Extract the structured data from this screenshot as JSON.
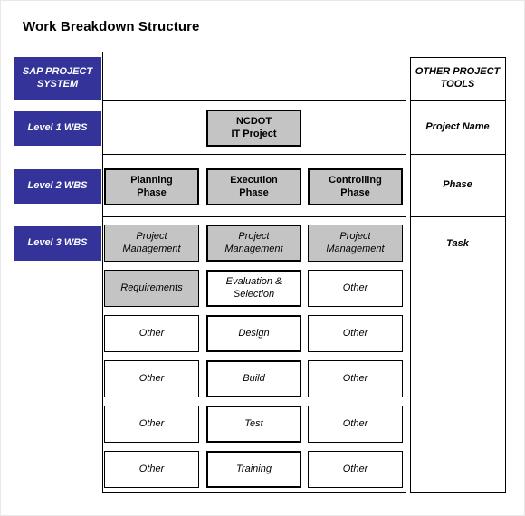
{
  "page": {
    "title": "Work Breakdown Structure",
    "colors": {
      "level_label_blue": "#333399",
      "node_gray": "#c4c4c4",
      "line_black": "#000000",
      "background": "#ffffff"
    }
  },
  "left_labels": [
    {
      "id": "sap-project-system",
      "line1": "SAP PROJECT",
      "line2": "SYSTEM"
    },
    {
      "id": "level-1-wbs",
      "line1": "Level 1 WBS",
      "line2": ""
    },
    {
      "id": "level-2-wbs",
      "line1": "Level 2 WBS",
      "line2": ""
    },
    {
      "id": "level-3-wbs",
      "line1": "Level 3 WBS",
      "line2": ""
    }
  ],
  "right_column": [
    {
      "id": "other-project-tools",
      "line1": "OTHER PROJECT",
      "line2": "TOOLS"
    },
    {
      "id": "project-name",
      "line1": "Project Name",
      "line2": ""
    },
    {
      "id": "phase",
      "line1": "Phase",
      "line2": ""
    },
    {
      "id": "task",
      "line1": "Task",
      "line2": ""
    }
  ],
  "level1": {
    "node": {
      "line1": "NCDOT",
      "line2": "IT Project",
      "fill": "gray",
      "border": "thick"
    }
  },
  "level2": {
    "nodes": [
      {
        "line1": "Planning",
        "line2": "Phase",
        "fill": "gray",
        "border": "thick"
      },
      {
        "line1": "Execution",
        "line2": "Phase",
        "fill": "gray",
        "border": "thick"
      },
      {
        "line1": "Controlling",
        "line2": "Phase",
        "fill": "gray",
        "border": "thick"
      }
    ]
  },
  "level3": {
    "rows": [
      {
        "cells": [
          {
            "line1": "Project",
            "line2": "Management",
            "fill": "gray",
            "border": "thin"
          },
          {
            "line1": "Project",
            "line2": "Management",
            "fill": "gray",
            "border": "thick"
          },
          {
            "line1": "Project",
            "line2": "Management",
            "fill": "gray",
            "border": "thin"
          }
        ]
      },
      {
        "cells": [
          {
            "line1": "Requirements",
            "line2": "",
            "fill": "gray",
            "border": "thin"
          },
          {
            "line1": "Evaluation &",
            "line2": "Selection",
            "fill": "white",
            "border": "thick"
          },
          {
            "line1": "Other",
            "line2": "",
            "fill": "white",
            "border": "thin"
          }
        ]
      },
      {
        "cells": [
          {
            "line1": "Other",
            "line2": "",
            "fill": "white",
            "border": "thin"
          },
          {
            "line1": "Design",
            "line2": "",
            "fill": "white",
            "border": "thick"
          },
          {
            "line1": "Other",
            "line2": "",
            "fill": "white",
            "border": "thin"
          }
        ]
      },
      {
        "cells": [
          {
            "line1": "Other",
            "line2": "",
            "fill": "white",
            "border": "thin"
          },
          {
            "line1": "Build",
            "line2": "",
            "fill": "white",
            "border": "thick"
          },
          {
            "line1": "Other",
            "line2": "",
            "fill": "white",
            "border": "thin"
          }
        ]
      },
      {
        "cells": [
          {
            "line1": "Other",
            "line2": "",
            "fill": "white",
            "border": "thin"
          },
          {
            "line1": "Test",
            "line2": "",
            "fill": "white",
            "border": "thick"
          },
          {
            "line1": "Other",
            "line2": "",
            "fill": "white",
            "border": "thin"
          }
        ]
      },
      {
        "cells": [
          {
            "line1": "Other",
            "line2": "",
            "fill": "white",
            "border": "thin"
          },
          {
            "line1": "Training",
            "line2": "",
            "fill": "white",
            "border": "thick"
          },
          {
            "line1": "Other",
            "line2": "",
            "fill": "white",
            "border": "thin"
          }
        ]
      }
    ]
  }
}
